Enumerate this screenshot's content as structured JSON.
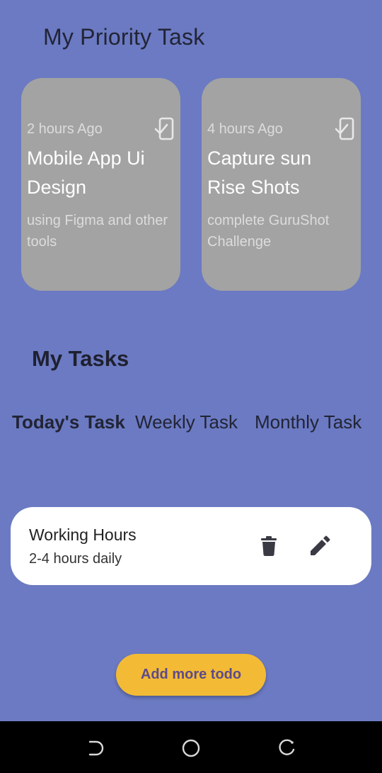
{
  "header": {
    "title": "My Priority Task"
  },
  "priority_cards": [
    {
      "time": "2 hours Ago",
      "title": "Mobile App Ui Design",
      "description": "using Figma and other tools",
      "icon": "phone-check-icon"
    },
    {
      "time": "4 hours Ago",
      "title": "Capture sun Rise Shots",
      "description": "complete GuruShot Challenge",
      "icon": "phone-check-icon"
    }
  ],
  "tasks_section": {
    "title": "My Tasks",
    "tabs": [
      {
        "label": "Today's Task",
        "active": true
      },
      {
        "label": "Weekly Task",
        "active": false
      },
      {
        "label": "Monthly Task",
        "active": false
      }
    ]
  },
  "task_list": [
    {
      "title": "Working Hours",
      "subtitle": "2-4 hours daily",
      "icons": [
        "delete-icon",
        "edit-icon"
      ]
    }
  ],
  "add_button": {
    "label": "Add more todo"
  },
  "colors": {
    "background": "#6b7ac2",
    "card": "#a3a3a3",
    "task_card": "#ffffff",
    "accent_button": "#f3bb35",
    "button_text": "#5e4a8a",
    "nav_bar": "#000000"
  }
}
